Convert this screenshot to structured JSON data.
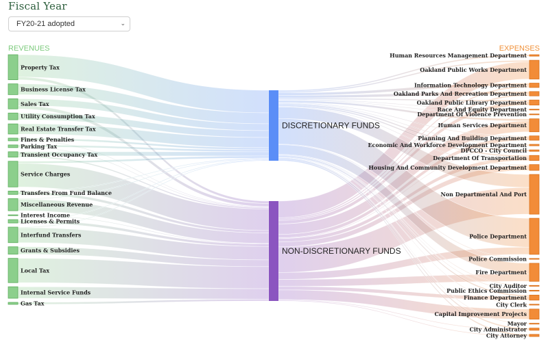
{
  "fiscal_year": {
    "title": "Fiscal Year",
    "selected": "FY20-21 adopted"
  },
  "headers": {
    "revenues": "REVENUES",
    "expenses": "EXPENSES"
  },
  "colors": {
    "revenue": "#8ccf8c",
    "discretionary": "#5b8ef7",
    "non_discretionary": "#8b55c0",
    "expense": "#f28c38"
  },
  "chart_data": {
    "type": "sankey",
    "title": "Fiscal Year FY20-21 adopted",
    "revenues": [
      {
        "name": "Property Tax",
        "share": 37
      },
      {
        "name": "Business License Tax",
        "share": 16
      },
      {
        "name": "Sales Tax",
        "share": 15
      },
      {
        "name": "Utility Consumption Tax",
        "share": 10
      },
      {
        "name": "Real Estate Transfer Tax",
        "share": 15
      },
      {
        "name": "Fines & Penalties",
        "share": 4
      },
      {
        "name": "Parking Tax",
        "share": 4
      },
      {
        "name": "Transient Occupancy Tax",
        "share": 8
      },
      {
        "name": "Service Charges",
        "share": 38
      },
      {
        "name": "Transfers From Fund Balance",
        "share": 5
      },
      {
        "name": "Miscellaneous Revenue",
        "share": 18
      },
      {
        "name": "Interest Income",
        "share": 1
      },
      {
        "name": "Licenses & Permits",
        "share": 5
      },
      {
        "name": "Interfund Transfers",
        "share": 23
      },
      {
        "name": "Grants & Subsidies",
        "share": 11
      },
      {
        "name": "Local Tax",
        "share": 36
      },
      {
        "name": "Internal Service Funds",
        "share": 17
      },
      {
        "name": "Gas Tax",
        "share": 3
      }
    ],
    "funds": [
      {
        "name": "DISCRETIONARY FUNDS",
        "share": 103
      },
      {
        "name": "NON-DISCRETIONARY FUNDS",
        "share": 146
      }
    ],
    "expenses": [
      {
        "name": "Human Resources Management Department",
        "share": 2
      },
      {
        "name": "Oakland Public Works Department",
        "share": 26
      },
      {
        "name": "Information Technology Department",
        "share": 6
      },
      {
        "name": "Oakland Parks And Recreation Department",
        "share": 6
      },
      {
        "name": "Oakland Public Library Department",
        "share": 7
      },
      {
        "name": "Race And Equity Department",
        "share": 1
      },
      {
        "name": "Department Of Violence Prevention",
        "share": 1
      },
      {
        "name": "Human Services Department",
        "share": 18
      },
      {
        "name": "Planning And Building Department",
        "share": 6
      },
      {
        "name": "Economic And Workforce Development Department",
        "share": 2
      },
      {
        "name": "DPCCO - City Council",
        "share": 2
      },
      {
        "name": "Department Of Transportation",
        "share": 7
      },
      {
        "name": "Housing And Community Development Department",
        "share": 8
      },
      {
        "name": "Non Departmental And Port",
        "share": 55
      },
      {
        "name": "Police Department",
        "share": 50
      },
      {
        "name": "Police Commission",
        "share": 1
      },
      {
        "name": "Fire Department",
        "share": 25
      },
      {
        "name": "City Auditor",
        "share": 1
      },
      {
        "name": "Public Ethics Commission",
        "share": 1
      },
      {
        "name": "Finance Department",
        "share": 7
      },
      {
        "name": "City Clerk",
        "share": 1
      },
      {
        "name": "Capital Improvement Projects",
        "share": 14
      },
      {
        "name": "Mayor",
        "share": 1
      },
      {
        "name": "City Administrator",
        "share": 3
      },
      {
        "name": "City Attorney",
        "share": 3
      }
    ],
    "revenue_to_fund": [
      {
        "source": "Property Tax",
        "target": "DISCRETIONARY FUNDS",
        "share": 33
      },
      {
        "source": "Property Tax",
        "target": "NON-DISCRETIONARY FUNDS",
        "share": 4
      },
      {
        "source": "Business License Tax",
        "target": "DISCRETIONARY FUNDS",
        "share": 16
      },
      {
        "source": "Sales Tax",
        "target": "DISCRETIONARY FUNDS",
        "share": 10
      },
      {
        "source": "Sales Tax",
        "target": "NON-DISCRETIONARY FUNDS",
        "share": 5
      },
      {
        "source": "Utility Consumption Tax",
        "target": "DISCRETIONARY FUNDS",
        "share": 10
      },
      {
        "source": "Real Estate Transfer Tax",
        "target": "DISCRETIONARY FUNDS",
        "share": 15
      },
      {
        "source": "Fines & Penalties",
        "target": "DISCRETIONARY FUNDS",
        "share": 3
      },
      {
        "source": "Fines & Penalties",
        "target": "NON-DISCRETIONARY FUNDS",
        "share": 1
      },
      {
        "source": "Parking Tax",
        "target": "DISCRETIONARY FUNDS",
        "share": 3
      },
      {
        "source": "Parking Tax",
        "target": "NON-DISCRETIONARY FUNDS",
        "share": 1
      },
      {
        "source": "Transient Occupancy Tax",
        "target": "DISCRETIONARY FUNDS",
        "share": 6
      },
      {
        "source": "Transient Occupancy Tax",
        "target": "NON-DISCRETIONARY FUNDS",
        "share": 2
      },
      {
        "source": "Service Charges",
        "target": "DISCRETIONARY FUNDS",
        "share": 3
      },
      {
        "source": "Service Charges",
        "target": "NON-DISCRETIONARY FUNDS",
        "share": 35
      },
      {
        "source": "Transfers From Fund Balance",
        "target": "DISCRETIONARY FUNDS",
        "share": 1
      },
      {
        "source": "Transfers From Fund Balance",
        "target": "NON-DISCRETIONARY FUNDS",
        "share": 4
      },
      {
        "source": "Miscellaneous Revenue",
        "target": "DISCRETIONARY FUNDS",
        "share": 1
      },
      {
        "source": "Miscellaneous Revenue",
        "target": "NON-DISCRETIONARY FUNDS",
        "share": 17
      },
      {
        "source": "Interest Income",
        "target": "NON-DISCRETIONARY FUNDS",
        "share": 1
      },
      {
        "source": "Licenses & Permits",
        "target": "DISCRETIONARY FUNDS",
        "share": 1
      },
      {
        "source": "Licenses & Permits",
        "target": "NON-DISCRETIONARY FUNDS",
        "share": 4
      },
      {
        "source": "Interfund Transfers",
        "target": "DISCRETIONARY FUNDS",
        "share": 1
      },
      {
        "source": "Interfund Transfers",
        "target": "NON-DISCRETIONARY FUNDS",
        "share": 22
      },
      {
        "source": "Grants & Subsidies",
        "target": "NON-DISCRETIONARY FUNDS",
        "share": 11
      },
      {
        "source": "Local Tax",
        "target": "NON-DISCRETIONARY FUNDS",
        "share": 36
      },
      {
        "source": "Internal Service Funds",
        "target": "NON-DISCRETIONARY FUNDS",
        "share": 17
      },
      {
        "source": "Gas Tax",
        "target": "NON-DISCRETIONARY FUNDS",
        "share": 3
      }
    ],
    "fund_to_expense": [
      {
        "source": "DISCRETIONARY FUNDS",
        "target": "Human Resources Management Department",
        "share": 2
      },
      {
        "source": "DISCRETIONARY FUNDS",
        "target": "Oakland Public Works Department",
        "share": 2
      },
      {
        "source": "NON-DISCRETIONARY FUNDS",
        "target": "Oakland Public Works Department",
        "share": 24
      },
      {
        "source": "DISCRETIONARY FUNDS",
        "target": "Information Technology Department",
        "share": 4
      },
      {
        "source": "NON-DISCRETIONARY FUNDS",
        "target": "Information Technology Department",
        "share": 2
      },
      {
        "source": "DISCRETIONARY FUNDS",
        "target": "Oakland Parks And Recreation Department",
        "share": 4
      },
      {
        "source": "NON-DISCRETIONARY FUNDS",
        "target": "Oakland Parks And Recreation Department",
        "share": 2
      },
      {
        "source": "DISCRETIONARY FUNDS",
        "target": "Oakland Public Library Department",
        "share": 2
      },
      {
        "source": "NON-DISCRETIONARY FUNDS",
        "target": "Oakland Public Library Department",
        "share": 5
      },
      {
        "source": "DISCRETIONARY FUNDS",
        "target": "Race And Equity Department",
        "share": 1
      },
      {
        "source": "DISCRETIONARY FUNDS",
        "target": "Department Of Violence Prevention",
        "share": 1
      },
      {
        "source": "DISCRETIONARY FUNDS",
        "target": "Human Services Department",
        "share": 3
      },
      {
        "source": "NON-DISCRETIONARY FUNDS",
        "target": "Human Services Department",
        "share": 15
      },
      {
        "source": "DISCRETIONARY FUNDS",
        "target": "Planning And Building Department",
        "share": 1
      },
      {
        "source": "NON-DISCRETIONARY FUNDS",
        "target": "Planning And Building Department",
        "share": 5
      },
      {
        "source": "DISCRETIONARY FUNDS",
        "target": "Economic And Workforce Development Department",
        "share": 1
      },
      {
        "source": "NON-DISCRETIONARY FUNDS",
        "target": "Economic And Workforce Development Department",
        "share": 1
      },
      {
        "source": "DISCRETIONARY FUNDS",
        "target": "DPCCO - City Council",
        "share": 2
      },
      {
        "source": "DISCRETIONARY FUNDS",
        "target": "Department Of Transportation",
        "share": 2
      },
      {
        "source": "NON-DISCRETIONARY FUNDS",
        "target": "Department Of Transportation",
        "share": 5
      },
      {
        "source": "DISCRETIONARY FUNDS",
        "target": "Housing And Community Development Department",
        "share": 1
      },
      {
        "source": "NON-DISCRETIONARY FUNDS",
        "target": "Housing And Community Development Department",
        "share": 7
      },
      {
        "source": "DISCRETIONARY FUNDS",
        "target": "Non Departmental And Port",
        "share": 18
      },
      {
        "source": "NON-DISCRETIONARY FUNDS",
        "target": "Non Departmental And Port",
        "share": 37
      },
      {
        "source": "DISCRETIONARY FUNDS",
        "target": "Police Department",
        "share": 40
      },
      {
        "source": "NON-DISCRETIONARY FUNDS",
        "target": "Police Department",
        "share": 10
      },
      {
        "source": "DISCRETIONARY FUNDS",
        "target": "Police Commission",
        "share": 1
      },
      {
        "source": "DISCRETIONARY FUNDS",
        "target": "Fire Department",
        "share": 15
      },
      {
        "source": "NON-DISCRETIONARY FUNDS",
        "target": "Fire Department",
        "share": 10
      },
      {
        "source": "DISCRETIONARY FUNDS",
        "target": "City Auditor",
        "share": 1
      },
      {
        "source": "DISCRETIONARY FUNDS",
        "target": "Public Ethics Commission",
        "share": 1
      },
      {
        "source": "DISCRETIONARY FUNDS",
        "target": "Finance Department",
        "share": 2
      },
      {
        "source": "NON-DISCRETIONARY FUNDS",
        "target": "Finance Department",
        "share": 5
      },
      {
        "source": "DISCRETIONARY FUNDS",
        "target": "City Clerk",
        "share": 1
      },
      {
        "source": "NON-DISCRETIONARY FUNDS",
        "target": "Capital Improvement Projects",
        "share": 14
      },
      {
        "source": "DISCRETIONARY FUNDS",
        "target": "Mayor",
        "share": 1
      },
      {
        "source": "DISCRETIONARY FUNDS",
        "target": "City Administrator",
        "share": 2
      },
      {
        "source": "NON-DISCRETIONARY FUNDS",
        "target": "City Administrator",
        "share": 1
      },
      {
        "source": "DISCRETIONARY FUNDS",
        "target": "City Attorney",
        "share": 2
      },
      {
        "source": "NON-DISCRETIONARY FUNDS",
        "target": "City Attorney",
        "share": 1
      }
    ]
  }
}
